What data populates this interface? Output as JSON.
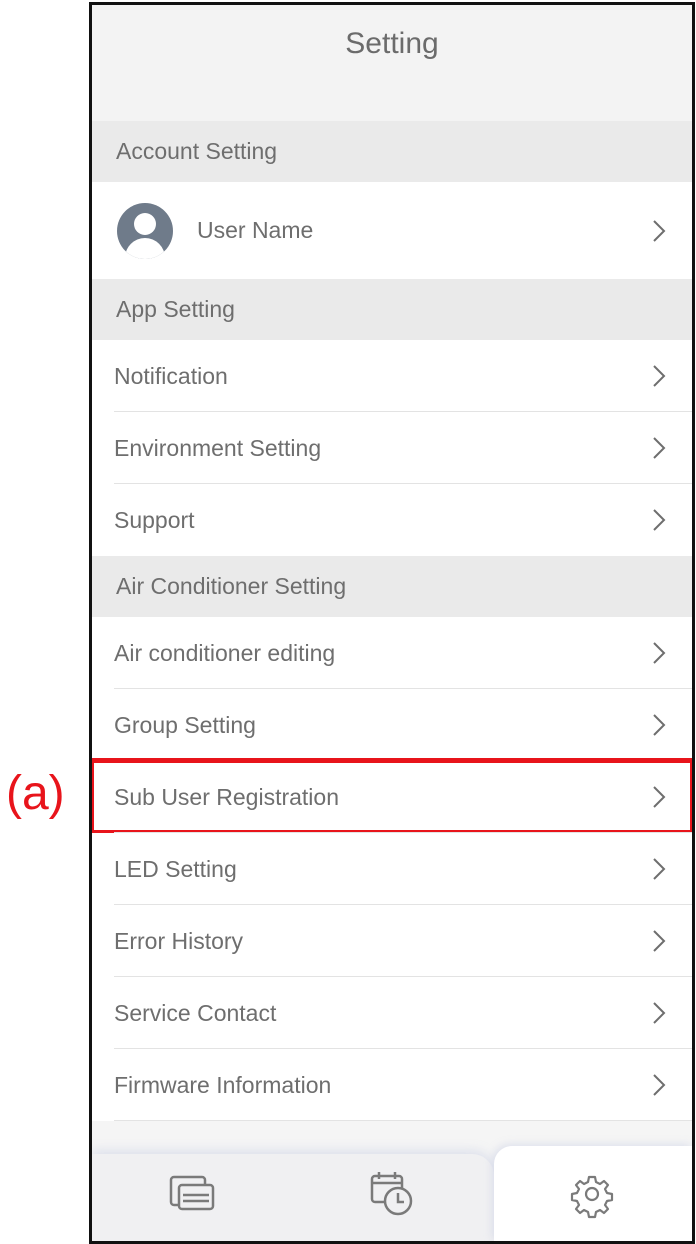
{
  "annotation": {
    "label": "(a)",
    "color": "#e8141b"
  },
  "header": {
    "title": "Setting"
  },
  "sections": {
    "account": {
      "title": "Account Setting",
      "user_name": "User Name"
    },
    "app": {
      "title": "App Setting",
      "items": [
        "Notification",
        "Environment Setting",
        "Support"
      ]
    },
    "air": {
      "title": "Air Conditioner Setting",
      "items": [
        "Air conditioner editing",
        "Group Setting",
        "Sub User Registration",
        "LED Setting",
        "Error History",
        "Service Contact",
        "Firmware Information"
      ]
    }
  },
  "tabbar": {
    "tabs": [
      {
        "icon": "devices-icon",
        "active": false
      },
      {
        "icon": "schedule-icon",
        "active": false
      },
      {
        "icon": "gear-icon",
        "active": true
      }
    ]
  },
  "colors": {
    "text": "#6e6e6e",
    "section_bg": "#eaeaea",
    "highlight": "#e8141b"
  }
}
